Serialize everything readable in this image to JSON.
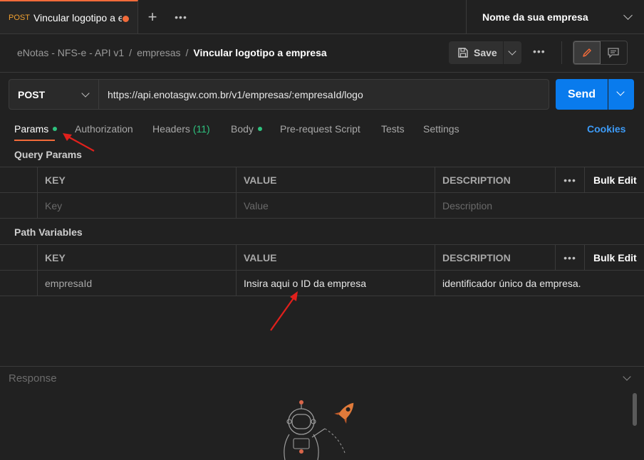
{
  "tabs": {
    "active": {
      "method": "POST",
      "title": "Vincular logotipo a empresa"
    }
  },
  "environment": {
    "label": "Nome da sua empresa"
  },
  "breadcrumb": {
    "items": [
      "eNotas - NFS-e - API v1",
      "empresas",
      "Vincular logotipo a empresa"
    ],
    "separator": "/"
  },
  "toolbar": {
    "save_label": "Save",
    "more_label": "•••"
  },
  "request": {
    "method": "POST",
    "url": "https://api.enotasgw.com.br/v1/empresas/:empresaId/logo",
    "send_label": "Send"
  },
  "request_tabs": {
    "params": "Params",
    "authorization": "Authorization",
    "headers": "Headers",
    "headers_count": "(11)",
    "body": "Body",
    "prerequest": "Pre-request Script",
    "tests": "Tests",
    "settings": "Settings",
    "cookies": "Cookies"
  },
  "query_params": {
    "title": "Query Params",
    "columns": {
      "key": "KEY",
      "value": "VALUE",
      "description": "DESCRIPTION"
    },
    "more": "•••",
    "bulk_edit": "Bulk Edit",
    "placeholder": {
      "key": "Key",
      "value": "Value",
      "description": "Description"
    }
  },
  "path_variables": {
    "title": "Path Variables",
    "columns": {
      "key": "KEY",
      "value": "VALUE",
      "description": "DESCRIPTION"
    },
    "more": "•••",
    "bulk_edit": "Bulk Edit",
    "rows": [
      {
        "key": "empresaId",
        "value": "Insira aqui o ID da empresa",
        "description": "identificador único da empresa."
      }
    ]
  },
  "response": {
    "label": "Response"
  },
  "colors": {
    "accent": "#f26b3a",
    "send": "#097bed",
    "link": "#3d9bf7",
    "green": "#2ec27e",
    "annotation_arrow": "#e0201c"
  }
}
